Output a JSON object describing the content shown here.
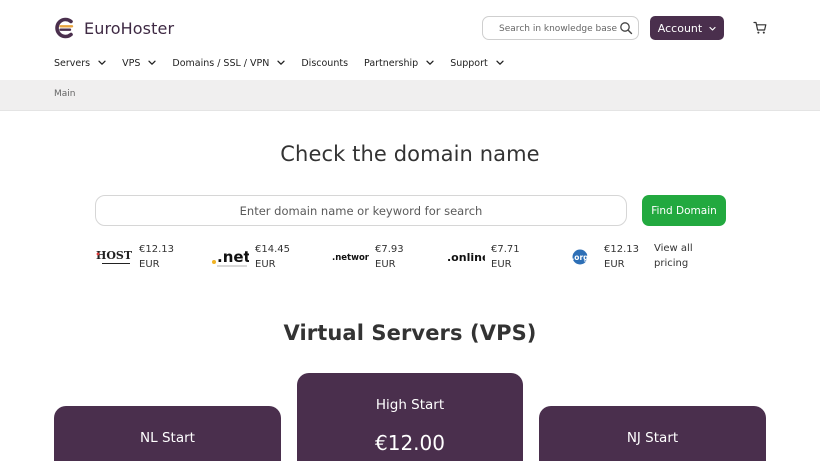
{
  "header": {
    "brand": "EuroHoster",
    "logo_icon": "eurohoster-logo-icon",
    "search": {
      "placeholder": "Search in knowledge base",
      "value": "",
      "icon": "search-icon"
    },
    "account": {
      "label": "Account",
      "icon": "chevron-down-icon"
    },
    "cart": {
      "icon": "cart-icon"
    }
  },
  "nav": {
    "items": [
      {
        "label": "Servers",
        "has_dropdown": true
      },
      {
        "label": "VPS",
        "has_dropdown": true
      },
      {
        "label": "Domains / SSL / VPN",
        "has_dropdown": true
      },
      {
        "label": "Discounts",
        "has_dropdown": false
      },
      {
        "label": "Partnership",
        "has_dropdown": true
      },
      {
        "label": "Support",
        "has_dropdown": true
      }
    ]
  },
  "breadcrumb": {
    "items": [
      "Main"
    ]
  },
  "domain_check": {
    "title": "Check the domain name",
    "input": {
      "placeholder": "Enter domain name or keyword for search",
      "value": ""
    },
    "button": "Find Domain",
    "tlds": [
      {
        "logo_text": "HOST",
        "price": "€12.13",
        "currency": "EUR"
      },
      {
        "logo_text": ".net",
        "price": "€14.45",
        "currency": "EUR"
      },
      {
        "logo_text": ".network",
        "price": "€7.93",
        "currency": "EUR"
      },
      {
        "logo_text": ".online",
        "price": "€7.71",
        "currency": "EUR"
      },
      {
        "logo_text": ".org",
        "price": "€12.13",
        "currency": "EUR"
      }
    ],
    "view_all": [
      "View all",
      "pricing"
    ]
  },
  "vps": {
    "title": "Virtual Servers (VPS)",
    "plans": [
      {
        "name": "NL Start",
        "price": ""
      },
      {
        "name": "High Start",
        "price": "€12.00"
      },
      {
        "name": "NJ Start",
        "price": ""
      }
    ]
  },
  "colors": {
    "brand_purple": "#4a2f4d",
    "logo_orange": "#e8a33d",
    "find_green": "#22a93f",
    "crumb_bg": "#f0efef"
  }
}
